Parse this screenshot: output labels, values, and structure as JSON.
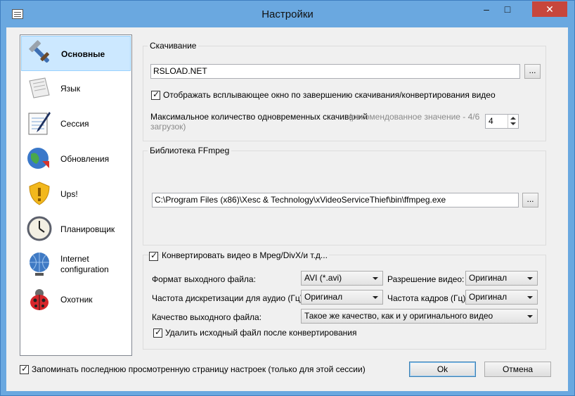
{
  "window": {
    "title": "Настройки",
    "min_glyph": "–",
    "max_glyph": "□",
    "close_glyph": "✕"
  },
  "sidebar": {
    "items": [
      {
        "label": "Основные",
        "icon": "tools-icon",
        "selected": true
      },
      {
        "label": "Язык",
        "icon": "scroll-icon",
        "selected": false
      },
      {
        "label": "Сессия",
        "icon": "notepad-pen-icon",
        "selected": false
      },
      {
        "label": "Обновления",
        "icon": "globe-update-icon",
        "selected": false
      },
      {
        "label": "Ups!",
        "icon": "warning-shield-icon",
        "selected": false
      },
      {
        "label": "Планировщик",
        "icon": "clock-icon",
        "selected": false
      },
      {
        "label": "Internet configuration",
        "icon": "network-globe-icon",
        "selected": false
      },
      {
        "label": "Охотник",
        "icon": "ladybug-icon",
        "selected": false
      }
    ]
  },
  "download": {
    "legend": "Скачивание",
    "folder_value": "RSLOAD.NET",
    "browse_label": "...",
    "popup_checkbox_label": "Отображать всплывающее окно по завершению скачивания/конвертирования видео",
    "max_downloads_label": "Максимальное количество одновременных скачиваний",
    "max_downloads_hint_1": "(рекомендованное значение - 4/6",
    "max_downloads_hint_2": "загрузок)",
    "max_downloads_value": "4"
  },
  "ffmpeg": {
    "legend": "Библиотека FFmpeg",
    "path_value": "C:\\Program Files (x86)\\Xesc & Technology\\xVideoServiceThief\\bin\\ffmpeg.exe",
    "browse_label": "..."
  },
  "convert": {
    "checkbox_label": "Конвертировать видео в Mpeg/DivX/и т.д...",
    "format_label": "Формат выходного файла:",
    "format_value": "AVI (*.avi)",
    "resolution_label": "Разрешение видео:",
    "resolution_value": "Оригинал",
    "audio_rate_label": "Частота дискретизации для аудио (Гц):",
    "audio_rate_value": "Оригинал",
    "frame_rate_label": "Частота кадров (Гц)",
    "frame_rate_value": "Оригинал",
    "quality_label": "Качество выходного файла:",
    "quality_value": "Такое же качество, как и у оригинального видео",
    "delete_checkbox_label": "Удалить исходный файл после конвертирования"
  },
  "footer": {
    "remember_label": "Запоминать последнюю просмотренную страницу настроек (только для этой сессии)",
    "ok_label": "Ok",
    "cancel_label": "Отмена"
  }
}
